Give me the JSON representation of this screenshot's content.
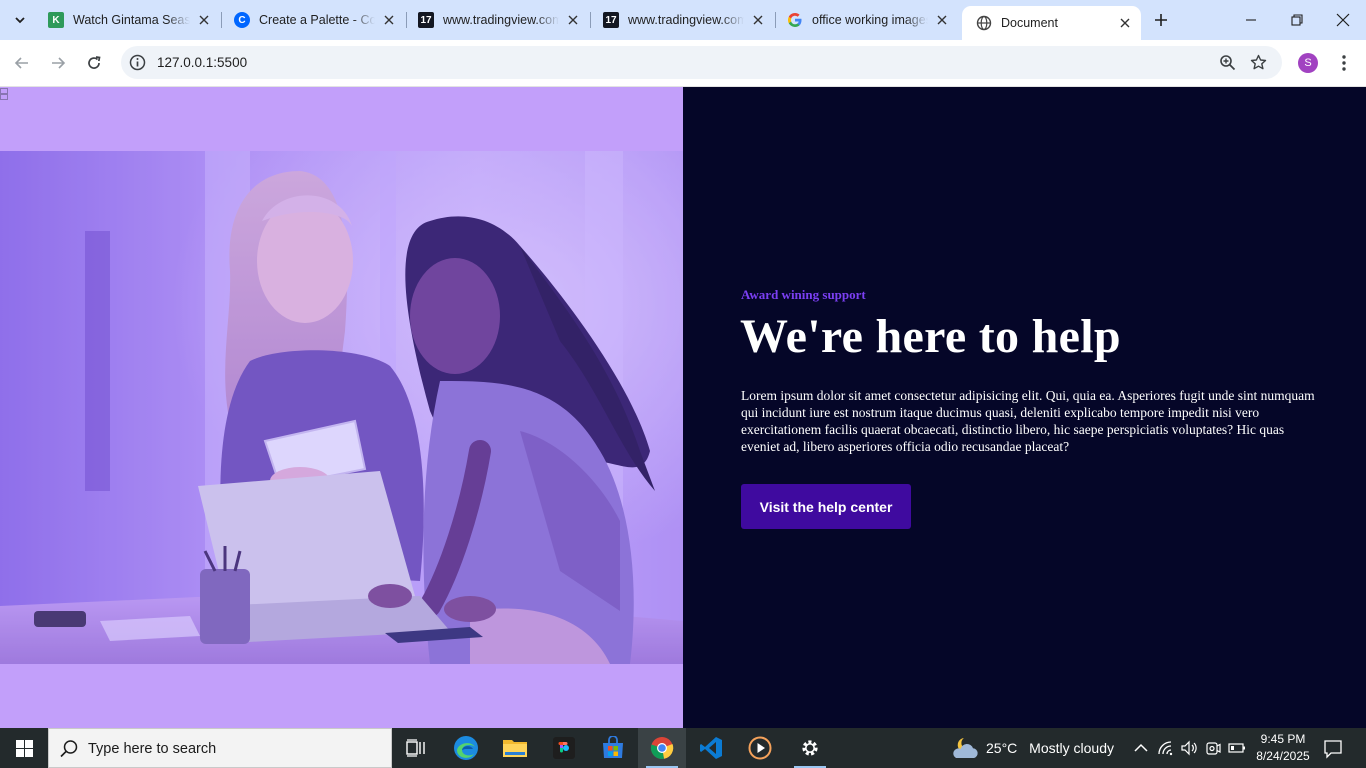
{
  "browser": {
    "tabs": [
      {
        "title": "Watch Gintama Season",
        "favicon": "k-favicon-icon",
        "active": false
      },
      {
        "title": "Create a Palette - Coolors",
        "favicon": "coolors-favicon-icon",
        "active": false
      },
      {
        "title": "www.tradingview.com",
        "favicon": "tradingview-favicon-icon",
        "active": false
      },
      {
        "title": "www.tradingview.com",
        "favicon": "tradingview-favicon-icon",
        "active": false
      },
      {
        "title": "office working images",
        "favicon": "google-favicon-icon",
        "active": false
      },
      {
        "title": "Document",
        "favicon": "globe-icon",
        "active": true
      }
    ],
    "url": "127.0.0.1:5500",
    "profile_initial": "S"
  },
  "page": {
    "eyebrow": "Award wining support",
    "headline": "We're here to help",
    "body": "Lorem ipsum dolor sit amet consectetur adipisicing elit. Qui, quia ea. Asperiores fugit unde sint numquam qui incidunt iure est nostrum itaque ducimus quasi, deleniti explicabo tempore impedit nisi vero exercitationem facilis quaerat obcaecati, distinctio libero, hic saepe perspiciatis voluptates? Hic quas eveniet ad, libero asperiores officia odio recusandae placeat?",
    "cta_label": "Visit the help center",
    "colors": {
      "left_bg": "#c29ffa",
      "right_bg": "#050628",
      "accent": "#7b3ff2",
      "button": "#3f0a9f"
    }
  },
  "taskbar": {
    "search_placeholder": "Type here to search",
    "apps": [
      "task-view-icon",
      "edge-icon",
      "file-explorer-icon",
      "figma-icon",
      "microsoft-store-icon",
      "chrome-icon",
      "vscode-icon",
      "media-player-icon",
      "settings-icon"
    ],
    "weather": {
      "temp": "25°C",
      "condition": "Mostly cloudy"
    },
    "time": "9:45 PM",
    "date": "8/24/2025"
  }
}
